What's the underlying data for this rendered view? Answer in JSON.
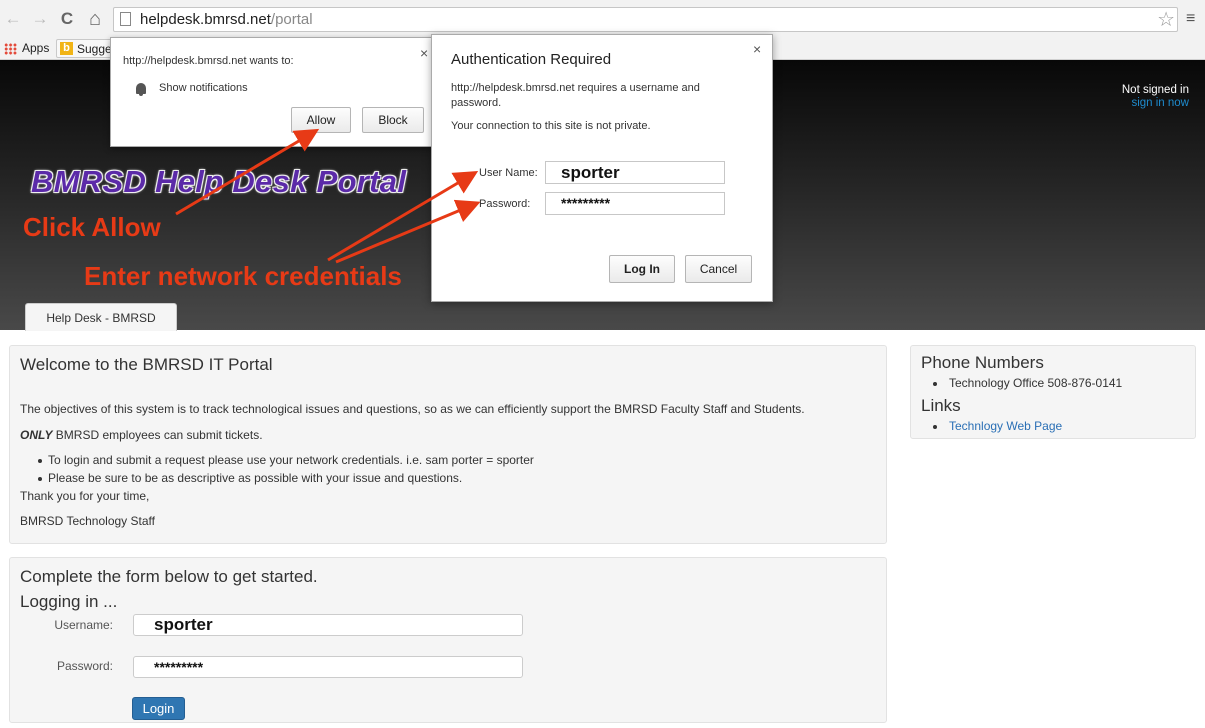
{
  "browser": {
    "nav": {
      "back_icon": "←",
      "forward_icon": "→",
      "reload_icon": "C",
      "home_icon": "⌂"
    },
    "url_host": "helpdesk.bmrsd.net",
    "url_path": "/portal",
    "star_icon": "☆",
    "menu_icon": "≡",
    "bookmarks": {
      "apps_label": "Apps",
      "bing_icon": "b",
      "suggested_label": "Sugge"
    }
  },
  "header": {
    "not_signed_in": "Not signed in",
    "sign_in": "sign in now",
    "site_title": "BMRSD Help Desk Portal",
    "annotation_allow": "Click Allow",
    "annotation_creds": "Enter network credentials",
    "tab_label": "Help Desk - BMRSD"
  },
  "welcome": {
    "heading": "Welcome to the BMRSD IT Portal",
    "objective": "The objectives of this system is to track technological issues and questions, so as we can efficiently support the BMRSD Faculty Staff and Students.",
    "only_strong": "ONLY",
    "only_rest": " BMRSD employees can submit tickets.",
    "bullets": [
      "To login and submit a request please use your network credentials. i.e. sam porter = sporter",
      "Please be sure to be as descriptive as possible with your issue and questions."
    ],
    "thanks": "Thank you for your time,",
    "signature": "BMRSD Technology Staff"
  },
  "form": {
    "heading": "Complete the form below to get started.",
    "subheading": "Logging in ...",
    "username_label": "Username:",
    "username_value": "sporter",
    "password_label": "Password:",
    "password_value": "*********",
    "login_label": "Login"
  },
  "sidebar": {
    "phone_heading": "Phone Numbers",
    "phone_item": "Technology Office 508-876-0141",
    "links_heading": "Links",
    "link_item": "Technlogy Web Page"
  },
  "notification": {
    "origin": "http://helpdesk.bmrsd.net wants to:",
    "close_icon": "×",
    "permission": "Show notifications",
    "allow_label": "Allow",
    "block_label": "Block"
  },
  "auth_dialog": {
    "title": "Authentication Required",
    "close_icon": "×",
    "message": "http://helpdesk.bmrsd.net requires a username and password.",
    "warning": "Your connection to this site is not private.",
    "username_label": "User Name:",
    "username_value": "sporter",
    "password_label": "Password:",
    "password_value": "*********",
    "login_label": "Log In",
    "cancel_label": "Cancel"
  },
  "colors": {
    "annotation": "#e73a16",
    "title_purple": "#5b2aa8",
    "link_blue": "#1e8bcd",
    "button_blue": "#2f76b2"
  }
}
